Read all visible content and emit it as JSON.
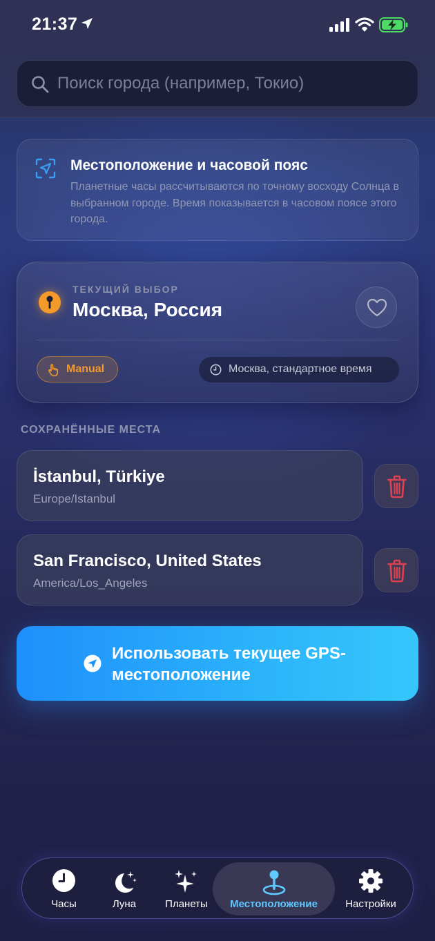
{
  "status_bar": {
    "time": "21:37",
    "icons": [
      "location-arrow-icon",
      "cellular-signal-icon",
      "wifi-icon",
      "battery-charging-icon"
    ]
  },
  "search": {
    "placeholder": "Поиск города (например, Токио)",
    "value": ""
  },
  "info_card": {
    "title": "Местоположение и часовой пояс",
    "text": "Планетные часы рассчитываются по точному восходу Солнца в выбранном городе. Время показывается в часовом поясе этого города."
  },
  "current": {
    "label": "ТЕКУЩИЙ ВЫБОР",
    "city": "Москва, Россия",
    "mode": "Manual",
    "timezone": "Москва, стандартное время"
  },
  "saved": {
    "header": "СОХРАНЁННЫЕ МЕСТА",
    "items": [
      {
        "city": "İstanbul, Türkiye",
        "tz": "Europe/Istanbul"
      },
      {
        "city": "San Francisco, United States",
        "tz": "America/Los_Angeles"
      }
    ]
  },
  "gps_button": {
    "label": "Использовать текущее GPS-местоположение"
  },
  "tabs": [
    {
      "label": "Часы",
      "icon": "clock-icon"
    },
    {
      "label": "Луна",
      "icon": "moon-stars-icon"
    },
    {
      "label": "Планеты",
      "icon": "sparkles-icon"
    },
    {
      "label": "Местоположение",
      "icon": "map-pin-icon",
      "active": true
    },
    {
      "label": "Настройки",
      "icon": "gear-icon"
    }
  ],
  "colors": {
    "accent_blue": "#2aa8fb",
    "accent_orange": "#f39a2a",
    "danger_red": "#e0414e",
    "active_tab": "#5fc8ff"
  }
}
